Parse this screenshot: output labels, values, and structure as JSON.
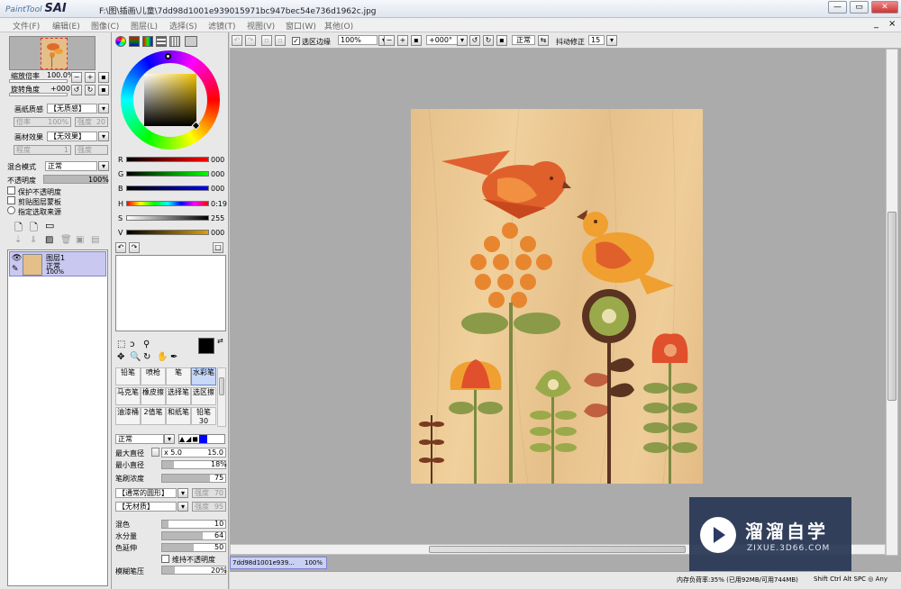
{
  "window": {
    "app_logo": "PaintTool",
    "app_name": "SAI",
    "file_path": "F:\\图\\插画\\儿童\\7dd98d1001e939015971bc947bec54e736d1962c.jpg",
    "minimize": "—",
    "maximize": "▭",
    "close": "✕"
  },
  "menu": [
    "文件(F)",
    "编辑(E)",
    "图像(C)",
    "图层(L)",
    "选择(S)",
    "滤镜(T)",
    "视图(V)",
    "窗口(W)",
    "其他(O)"
  ],
  "menu_right": {
    "min": "_",
    "close": "×"
  },
  "navigator": {
    "zoom_label": "缩放倍率",
    "zoom_value": "100.0%",
    "rotate_label": "旋转角度",
    "rotate_value": "+000°"
  },
  "paper": {
    "texture_label": "画纸质感",
    "texture_value": "【无质感】",
    "texture_amount_label": "倍率",
    "texture_amount": "100%",
    "texture_strength_label": "强度",
    "texture_strength": "20",
    "effect_label": "画材效果",
    "effect_value": "【无效果】",
    "effect_amount_label": "程度",
    "effect_amount": "1",
    "effect_strength_label": "强度",
    "effect_strength": "100"
  },
  "layer": {
    "blend_label": "混合模式",
    "blend_value": "正常",
    "opacity_label": "不透明度",
    "opacity_value": "100%",
    "protect_opacity": "保护不透明度",
    "clip_group": "剪贴图层蒙板",
    "selection_source": "指定选取来源",
    "name": "图层1",
    "mode": "正常",
    "opacity": "100%"
  },
  "color": {
    "r_label": "R",
    "r": "000",
    "g_label": "G",
    "g": "000",
    "b_label": "B",
    "b": "000",
    "h_label": "H",
    "h": "0:19",
    "s_label": "S",
    "s": "255",
    "v_label": "V",
    "v": "000"
  },
  "tools": {
    "brushes": [
      {
        "label": "铅笔",
        "selected": false
      },
      {
        "label": "喷枪",
        "selected": false
      },
      {
        "label": "笔",
        "selected": false
      },
      {
        "label": "水彩笔",
        "selected": true
      },
      {
        "label": "马克笔",
        "selected": false
      },
      {
        "label": "橡皮擦",
        "selected": false
      },
      {
        "label": "选择笔",
        "selected": false
      },
      {
        "label": "选区擦",
        "selected": false
      },
      {
        "label": "油漆桶",
        "selected": false
      },
      {
        "label": "2值笔",
        "selected": false
      },
      {
        "label": "和纸笔",
        "selected": false
      },
      {
        "label": "铅笔30",
        "selected": false
      }
    ]
  },
  "brush": {
    "mode": "正常",
    "max_diam_label": "最大直径",
    "max_diam_mult": "x 5.0",
    "max_diam": "15.0",
    "min_diam_label": "最小直径",
    "min_diam": "18%",
    "density_label": "笔刷浓度",
    "density": "75",
    "shape_value": "【通常的圆形】",
    "shape_strength_label": "强度",
    "shape_strength": "70",
    "texture_value": "【无材质】",
    "texture_strength_label": "强度",
    "texture_strength": "95",
    "blend_label": "混色",
    "blend": "10",
    "water_label": "水分量",
    "water": "64",
    "persistence_label": "色延伸",
    "persistence": "50",
    "keep_opacity": "维持不透明度",
    "blur_label": "模糊笔压",
    "blur": "20%"
  },
  "canvas_toolbar": {
    "selection_edge": "选区边缘",
    "zoom": "100%",
    "rotate": "+000°",
    "mode": "正常",
    "stabilizer_label": "抖动修正",
    "stabilizer": "15"
  },
  "doc_tab": {
    "name": "7dd98d1001e939...",
    "zoom": "100%"
  },
  "status": {
    "memory": "内存负荷率:35% (已用92MB/可用744MB)",
    "keys": "Shift Ctrl Alt SPC ◎ Any"
  },
  "watermark": {
    "brand": "溜溜自学",
    "url": "ZIXUE.3D66.COM"
  },
  "colors": {
    "selected_brush": "#c8d8f8",
    "canvas_bg": "#ababab",
    "wood": "#e8c48e"
  }
}
